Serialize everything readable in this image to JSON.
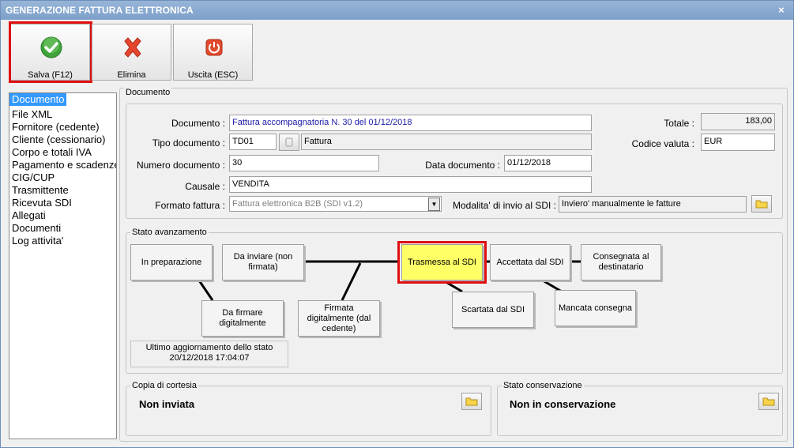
{
  "window": {
    "title": "GENERAZIONE FATTURA ELETTRONICA",
    "close": "×"
  },
  "toolbar": {
    "save_label": "Salva (F12)",
    "delete_label": "Elimina",
    "exit_label": "Uscita (ESC)"
  },
  "sidebar": {
    "items": [
      {
        "label": "Documento"
      },
      {
        "label": "File XML"
      },
      {
        "label": "Fornitore (cedente)"
      },
      {
        "label": "Cliente (cessionario)"
      },
      {
        "label": "Corpo e totali IVA"
      },
      {
        "label": "Pagamento e scadenze"
      },
      {
        "label": "CIG/CUP"
      },
      {
        "label": "Trasmittente"
      },
      {
        "label": "Ricevuta SDI"
      },
      {
        "label": "Allegati"
      },
      {
        "label": "Documenti"
      },
      {
        "label": "Log attivita'"
      }
    ]
  },
  "document_group": {
    "title": "Documento",
    "documento_label": "Documento :",
    "documento_value": "Fattura accompagnatoria N. 30 del 01/12/2018",
    "tipo_label": "Tipo documento :",
    "tipo_code": "TD01",
    "tipo_desc": "Fattura",
    "numero_label": "Numero documento :",
    "numero_value": "30",
    "data_label": "Data documento :",
    "data_value": "01/12/2018",
    "causale_label": "Causale :",
    "causale_value": "VENDITA",
    "formato_label": "Formato fattura :",
    "formato_value": "Fattura elettronica B2B (SDI v1.2)",
    "modalita_label": "Modalita' di invio al SDI :",
    "modalita_value": "Inviero' manualmente le fatture",
    "totale_label": "Totale :",
    "totale_value": "183,00",
    "valuta_label": "Codice valuta :",
    "valuta_value": "EUR"
  },
  "stato_group": {
    "title": "Stato avanzamento",
    "states": {
      "preparazione": "In preparazione",
      "da_inviare": "Da inviare (non firmata)",
      "da_firmare": "Da firmare digitalmente",
      "firmata": "Firmata digitalmente (dal cedente)",
      "trasmessa": "Trasmessa al SDI",
      "accettata": "Accettata dal SDI",
      "consegnata": "Consegnata al destinatario",
      "scartata": "Scartata dal SDI",
      "mancata": "Mancata consegna"
    },
    "last_update_label": "Ultimo aggiornamento dello stato",
    "last_update_value": "20/12/2018 17:04:07",
    "active_color": "#ffff66"
  },
  "cortesia_group": {
    "title": "Copia di cortesia",
    "value": "Non inviata"
  },
  "conservazione_group": {
    "title": "Stato conservazione",
    "value": "Non in conservazione"
  },
  "colors": {
    "highlight": "#e01010",
    "selection": "#3399ff",
    "title_bar": "#7d9fc9"
  }
}
